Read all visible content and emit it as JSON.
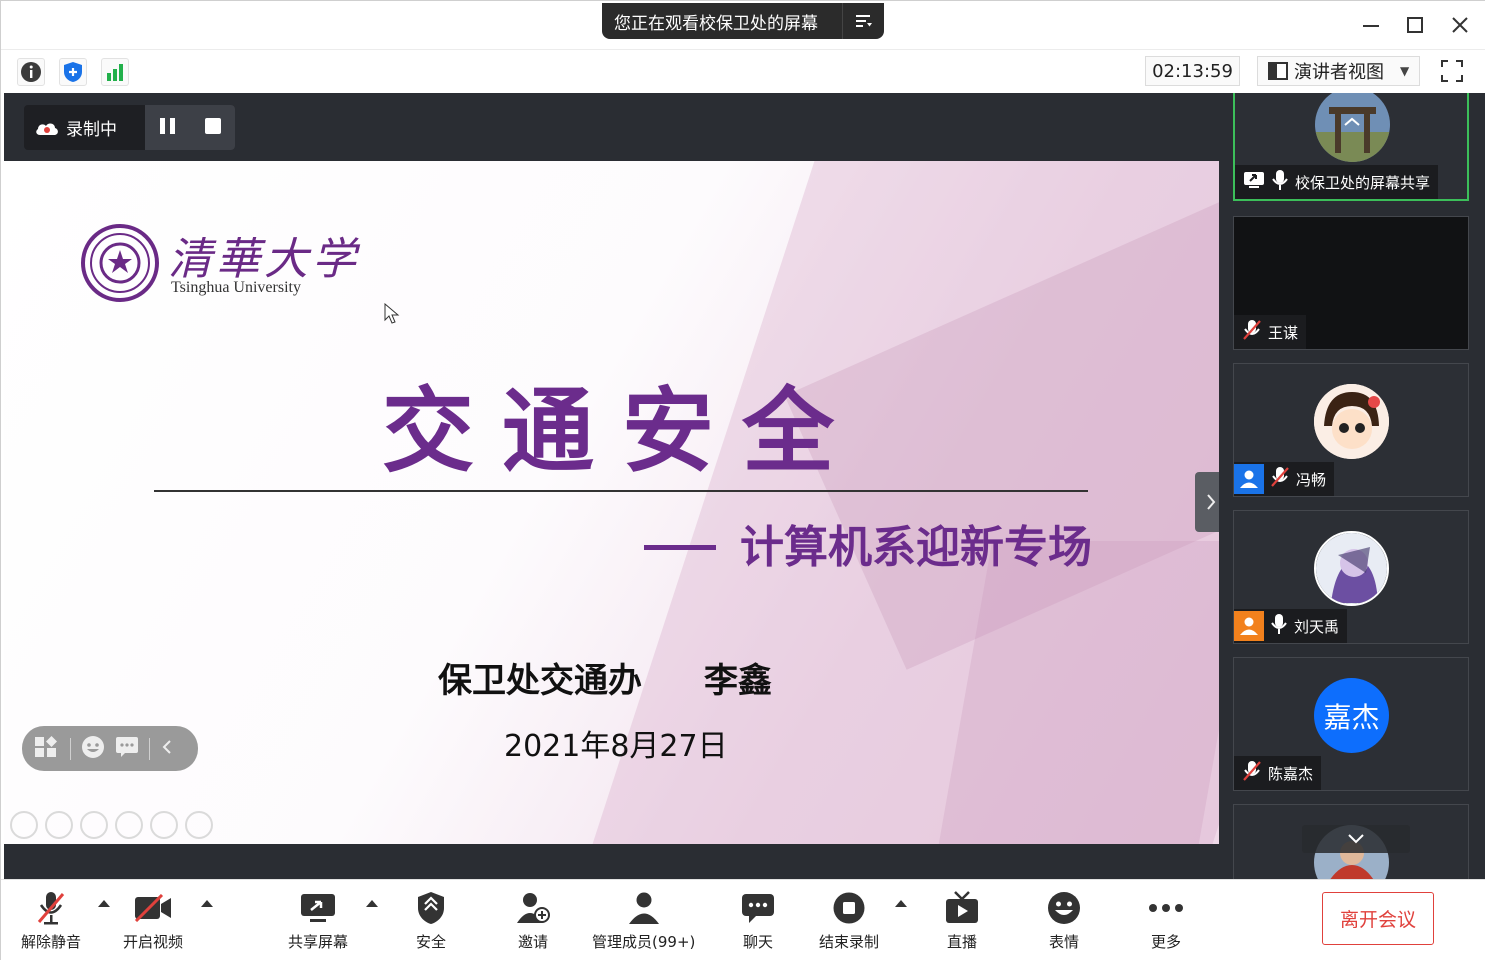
{
  "titlebar": {
    "share_notice": "您正在观看校保卫处的屏幕"
  },
  "infobar": {
    "timer": "02:13:59",
    "view_mode": "演讲者视图"
  },
  "recording": {
    "label": "录制中"
  },
  "slide": {
    "university_cn": "清華大学",
    "university_en": "Tsinghua University",
    "title": "交通安全",
    "subtitle": "计算机系迎新专场",
    "presenter_org": "保卫处交通办",
    "presenter_name": "李鑫",
    "date": "2021年8月27日"
  },
  "participants": [
    {
      "name": "校保卫处的屏幕共享",
      "mic": "on",
      "role": "sharing"
    },
    {
      "name": "王谋",
      "mic": "muted"
    },
    {
      "name": "冯畅",
      "mic": "muted",
      "badge_color": "#1a73e8"
    },
    {
      "name": "刘天禹",
      "mic": "on",
      "badge_color": "#f2811d"
    },
    {
      "name": "陈嘉杰",
      "mic": "muted",
      "initials": "嘉杰"
    }
  ],
  "toolbar": {
    "unmute": "解除静音",
    "start_video": "开启视频",
    "share_screen": "共享屏幕",
    "security": "安全",
    "invite": "邀请",
    "manage_members": "管理成员(99+)",
    "chat": "聊天",
    "end_recording": "结束录制",
    "live": "直播",
    "reactions": "表情",
    "more": "更多",
    "leave": "离开会议"
  },
  "colors": {
    "slide_purple": "#6b2c8c",
    "active_speaker": "#3cbf5a",
    "leave_red": "#e0413c",
    "stage_bg": "#2a2d33"
  }
}
